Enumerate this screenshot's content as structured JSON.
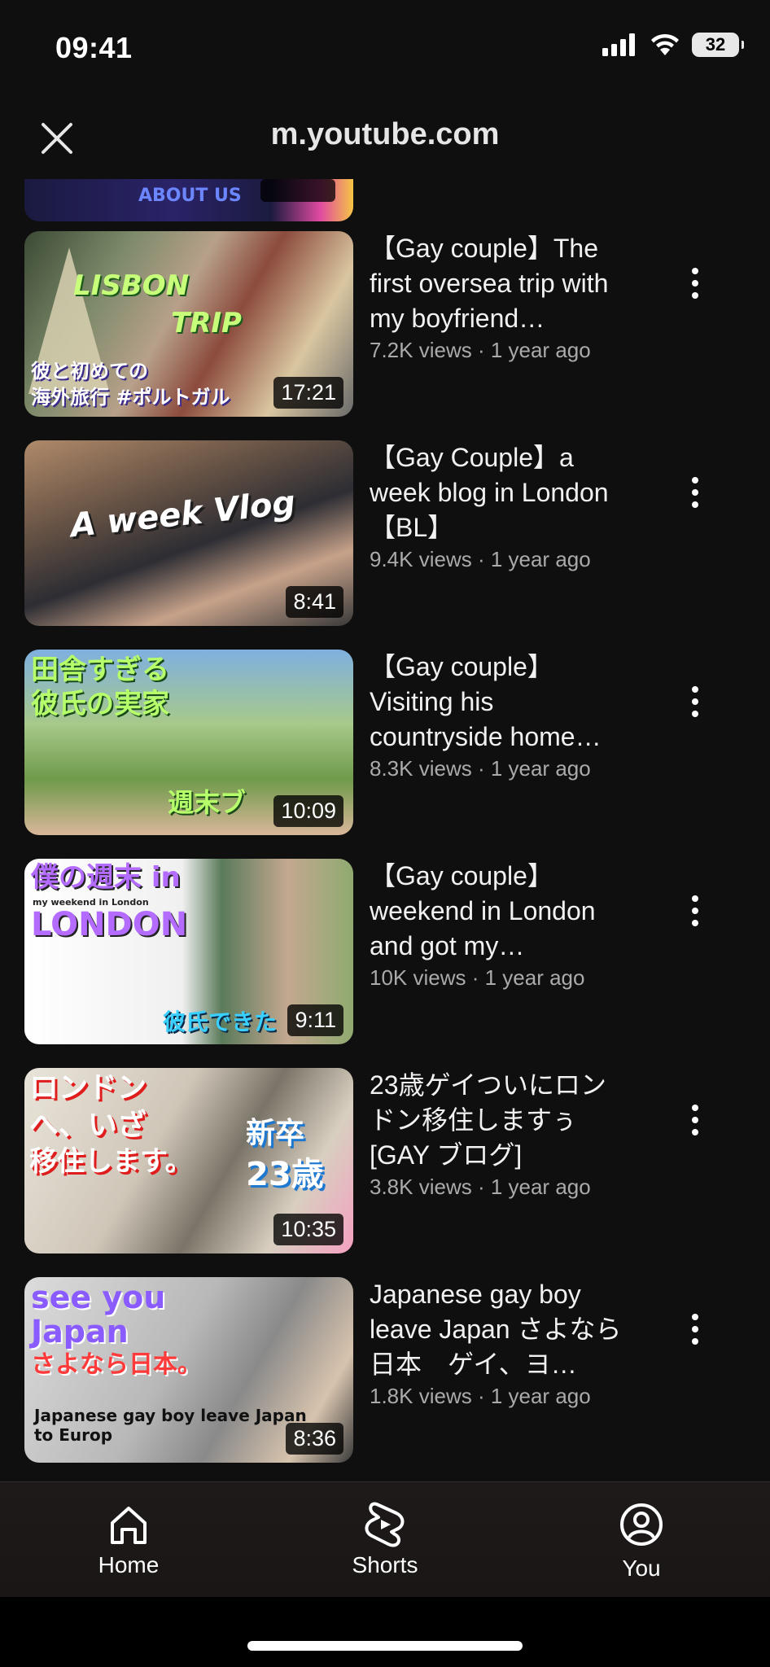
{
  "status_bar": {
    "time": "09:41",
    "battery": "32"
  },
  "browser": {
    "url": "m.youtube.com",
    "close_icon": "close-icon"
  },
  "partial_item": {
    "caption": "ABOUT US"
  },
  "videos": [
    {
      "title": "【Gay couple】The first oversea trip with my boyfriend…",
      "meta": "7.2K views · 1 year ago",
      "duration": "17:21",
      "thumb_texts": [
        "LISBON",
        "TRIP",
        "彼と初めての",
        "海外旅行 #ポルトガル"
      ]
    },
    {
      "title": "【Gay Couple】a week blog in London 【BL】",
      "meta": "9.4K views · 1 year ago",
      "duration": "8:41",
      "thumb_texts": [
        "A week Vlog"
      ]
    },
    {
      "title": "【Gay couple】Visiting his countryside home…",
      "meta": "8.3K views · 1 year ago",
      "duration": "10:09",
      "thumb_texts": [
        "田舎すぎる",
        "彼氏の実家",
        "週末ブ"
      ]
    },
    {
      "title": "【Gay couple】weekend in London and got my…",
      "meta": "10K views · 1 year ago",
      "duration": "9:11",
      "thumb_texts": [
        "僕の週末 in",
        "my weekend in London",
        "LONDON",
        "彼氏できた"
      ]
    },
    {
      "title": "23歳ゲイついにロンドン移住しますぅ [GAY ブログ]",
      "meta": "3.8K views · 1 year ago",
      "duration": "10:35",
      "thumb_texts": [
        "ロンドン",
        "へ、いざ",
        "移住します。",
        "新卒",
        "23歳"
      ]
    },
    {
      "title": "Japanese gay boy leave Japan さよなら日本　ゲイ、ヨ…",
      "meta": "1.8K views · 1 year ago",
      "duration": "8:36",
      "thumb_texts": [
        "see you",
        "Japan",
        "さよなら日本。",
        "Japanese gay boy leave Japan",
        "to Europ"
      ]
    }
  ],
  "nav": [
    {
      "label": "Home",
      "icon": "home-icon"
    },
    {
      "label": "Shorts",
      "icon": "shorts-icon"
    },
    {
      "label": "You",
      "icon": "account-icon"
    }
  ],
  "colors": {
    "background": "#0f0f0f",
    "text": "#f1f1f1",
    "meta": "#aaaaaa"
  }
}
